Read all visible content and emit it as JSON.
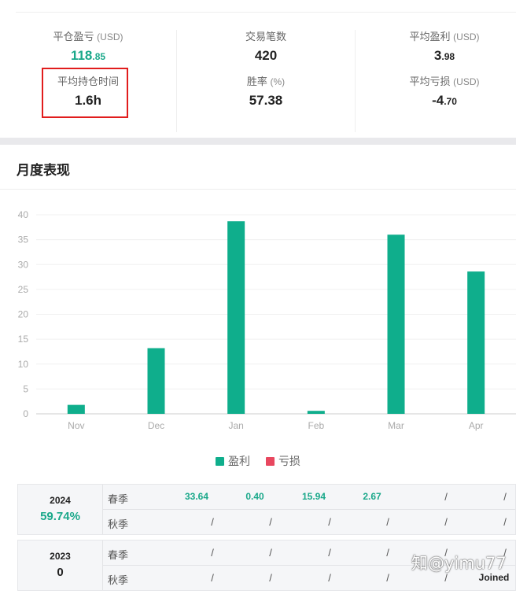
{
  "stats": {
    "pnl": {
      "label": "平仓盈亏",
      "unit": "(USD)",
      "int": "118",
      "dec": ".85"
    },
    "trades": {
      "label": "交易笔数",
      "value": "420"
    },
    "avg_profit": {
      "label": "平均盈利",
      "unit": "(USD)",
      "int": "3",
      "dec": ".98"
    },
    "avg_hold": {
      "label": "平均持仓时间",
      "value": "1.6h"
    },
    "win_rate": {
      "label": "胜率",
      "unit": "(%)",
      "value": "57.38"
    },
    "avg_loss": {
      "label": "平均亏损",
      "unit": "(USD)",
      "int": "-4",
      "dec": ".70"
    }
  },
  "section_title": "月度表现",
  "chart_data": {
    "type": "bar",
    "title": "",
    "categories": [
      "Nov",
      "Dec",
      "Jan",
      "Feb",
      "Mar",
      "Apr"
    ],
    "series": [
      {
        "name": "盈利",
        "color": "#0fae8c",
        "values": [
          1.8,
          13.2,
          38.7,
          0.6,
          36.0,
          28.6
        ]
      },
      {
        "name": "亏损",
        "color": "#e8475f",
        "values": [
          0,
          0,
          0,
          0,
          0,
          0
        ]
      }
    ],
    "ylim": [
      0,
      40
    ],
    "yticks": [
      "0",
      "5",
      "10",
      "15",
      "20",
      "25",
      "30",
      "35",
      "40"
    ],
    "grid": true,
    "legend": "bottom"
  },
  "tables": [
    {
      "year": "2024",
      "rate": "59.74%",
      "rows": [
        {
          "season": "春季",
          "cells": [
            "33.64",
            "0.40",
            "15.94",
            "2.67",
            "/",
            "/"
          ]
        },
        {
          "season": "秋季",
          "cells": [
            "/",
            "/",
            "/",
            "/",
            "/",
            "/"
          ]
        }
      ]
    },
    {
      "year": "2023",
      "rate": "0",
      "rows": [
        {
          "season": "春季",
          "cells": [
            "/",
            "/",
            "/",
            "/",
            "/",
            "/"
          ]
        },
        {
          "season": "秋季",
          "cells": [
            "/",
            "/",
            "/",
            "/",
            "/",
            "Joined"
          ]
        }
      ]
    }
  ],
  "watermark": "知@yimu77"
}
